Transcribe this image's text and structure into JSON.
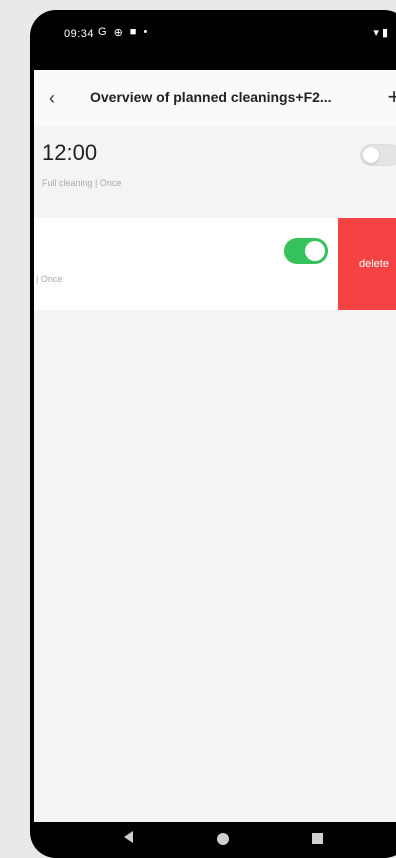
{
  "status_bar": {
    "time": "09:34",
    "icons_left": [
      "G",
      "⊕",
      "■",
      "•"
    ],
    "icons_right": [
      "▾",
      "▮"
    ]
  },
  "header": {
    "back_icon": "‹",
    "title": "Overview of planned cleanings+F2...",
    "add_icon": "+"
  },
  "schedules": [
    {
      "time": "12:00",
      "subtitle": "Full cleaning | Once",
      "enabled": false
    },
    {
      "time": "",
      "subtitle": "| Once",
      "enabled": true,
      "delete_label": "delete"
    }
  ],
  "colors": {
    "toggle_on": "#35c25a",
    "delete": "#f54343"
  }
}
